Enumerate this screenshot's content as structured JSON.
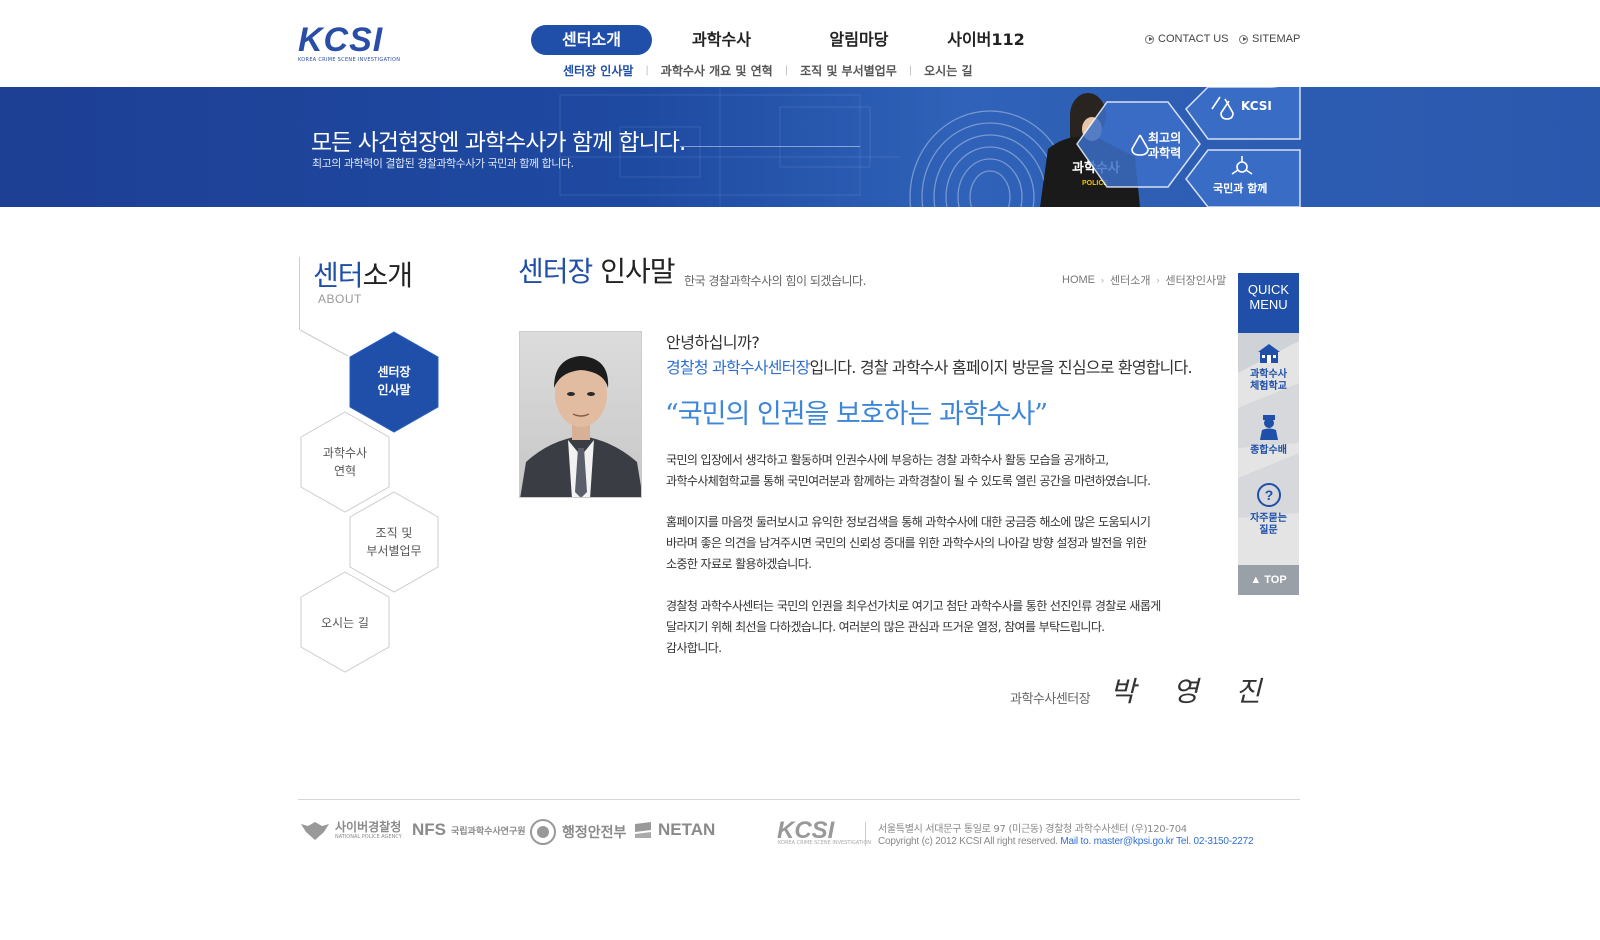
{
  "header": {
    "logo_text": "KCSI",
    "logo_sub": "KOREA CRIME SCENE INVESTIGATION",
    "gnb": [
      {
        "label": "센터소개",
        "active": true
      },
      {
        "label": "과학수사",
        "active": false
      },
      {
        "label": "알림마당",
        "active": false
      },
      {
        "label": "사이버112",
        "active": false
      }
    ],
    "util": {
      "contact": "CONTACT US",
      "sitemap": "SITEMAP"
    },
    "lnb": [
      {
        "label": "센터장 인사말",
        "active": true
      },
      {
        "label": "과학수사 개요 및 연혁",
        "active": false
      },
      {
        "label": "조직 및 부서별업무",
        "active": false
      },
      {
        "label": "오시는 길",
        "active": false
      }
    ]
  },
  "banner": {
    "title": "모든 사건현장엔 과학수사가 함께 합니다.",
    "subtitle": "최고의 과학력이 결합된 경찰과학수사가 국민과 함께 합니다.",
    "hex_kcsi": "KCSI",
    "hex_science": "최고의\n과학력",
    "hex_science_1": "최고의",
    "hex_science_2": "과학력",
    "hex_people": "국민과 함께",
    "vest_text": "과학수사",
    "vest_sub": "POLICE"
  },
  "sidebar": {
    "title_blue": "센터",
    "title_dark": "소개",
    "sub": "ABOUT",
    "items": [
      {
        "line1": "센터장",
        "line2": "인사말",
        "active": true
      },
      {
        "line1": "과학수사",
        "line2": "연혁",
        "active": false
      },
      {
        "line1": "조직 및",
        "line2": "부서별업무",
        "active": false
      },
      {
        "line1": "오시는 길",
        "line2": "",
        "active": false
      }
    ]
  },
  "content": {
    "title_blue": "센터장",
    "title_dark": "인사말",
    "desc": "한국 경찰과학수사의 힘이 되겠습니다.",
    "breadcrumb": [
      "HOME",
      "센터소개",
      "센터장인사말"
    ],
    "greeting1": "안녕하십니까?",
    "greeting2_hl": "경찰청 과학수사센터장",
    "greeting2_rest": "입니다. 경찰 과학수사 홈페이지 방문을 진심으로 환영합니다.",
    "quote": "“국민의 인권을 보호하는 과학수사”",
    "para1_l1": "국민의 입장에서 생각하고 활동하며 인권수사에 부응하는 경찰 과학수사 활동 모습을 공개하고,",
    "para1_l2": "과학수사체험학교를 통해 국민여러분과 함께하는 과학경찰이 될 수 있도록 열린 공간을 마련하였습니다.",
    "para2_l1": "홈페이지를 마음껏 둘러보시고 유익한 정보검색을 통해 과학수사에 대한 궁금증 해소에 많은 도움되시기",
    "para2_l2": "바라며 좋은 의견을 남겨주시면 국민의 신뢰성 증대를 위한 과학수사의 나아갈 방향 설정과 발전을 위한",
    "para2_l3": "소중한 자료로 활용하겠습니다.",
    "para3_l1": "경찰청 과학수사센터는 국민의 인권을 최우선가치로 여기고 첨단 과학수사를 통한 선진인류 경찰로 새롭게",
    "para3_l2": "달라지기 위해 최선을 다하겠습니다. 여러분의 많은 관심과 뜨거운 열정, 참여를 부탁드립니다.",
    "para3_l3": "감사합니다.",
    "sign_label": "과학수사센터장",
    "sign_name": "박 영 진"
  },
  "quick_menu": {
    "head1": "QUICK",
    "head2": "MENU",
    "items": [
      {
        "line1": "과학수사",
        "line2": "체험학교",
        "icon": "school-icon"
      },
      {
        "line1": "종합수배",
        "line2": "",
        "icon": "police-officer-icon"
      },
      {
        "line1": "자주묻는",
        "line2": "질문",
        "icon": "question-icon"
      }
    ],
    "top": "▲ TOP"
  },
  "footer": {
    "logos": {
      "cyber": "사이버경찰청",
      "cyber_sub": "NATIONAL POLICE AGENCY",
      "nfs": "NFS",
      "nfs_sub": "국립과학수사연구원",
      "mopas": "행정안전부",
      "netan": "NETAN"
    },
    "kcsi": "KCSI",
    "kcsi_sub": "KOREA CRIME SCENE INVESTIGATION",
    "address": "서울특별시 서대문구 통일로 97 (미근동) 경찰청 과학수사센터 (우)120-704",
    "copyright": "Copyright (c) 2012 KCSI All right reserved.",
    "contact": "Mail to. master@kpsi.go.kr Tel. 02-3150-2272"
  },
  "colors": {
    "brand_blue": "#1f4fa8",
    "highlight_blue": "#2f6fd0",
    "quote_blue": "#3e86d8"
  }
}
